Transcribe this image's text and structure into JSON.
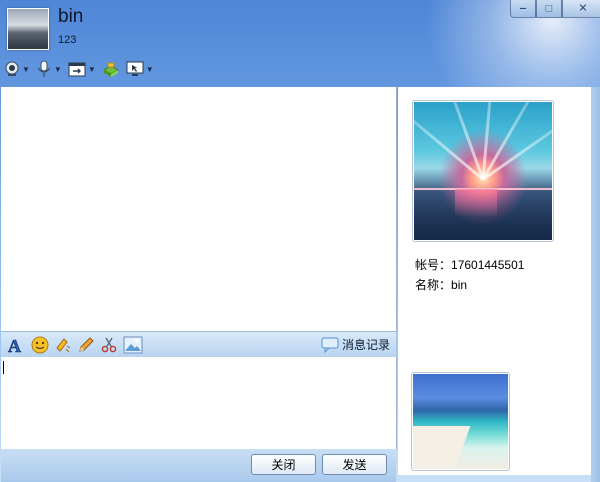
{
  "window": {
    "controls": {
      "minimize": "‒",
      "maximize": "□",
      "close": "✕"
    }
  },
  "header": {
    "name": "bin",
    "status": "123",
    "avatar_icon": "avatar-photo"
  },
  "toolbar": {
    "items": [
      {
        "icon": "camera-icon",
        "dropdown": true
      },
      {
        "icon": "microphone-icon",
        "dropdown": true
      },
      {
        "icon": "file-transfer-icon",
        "dropdown": true
      },
      {
        "icon": "app-box-icon",
        "dropdown": false
      },
      {
        "icon": "screen-share-icon",
        "dropdown": true
      }
    ]
  },
  "input_toolbar": {
    "icons": [
      "font-icon",
      "emoji-icon",
      "shake-icon",
      "pencil-icon",
      "scissors-icon",
      "image-icon"
    ],
    "history_label": "消息记录"
  },
  "buttons": {
    "close": "关闭",
    "send": "发送"
  },
  "profile": {
    "account_label": "帐号：",
    "account_value": "17601445501",
    "name_label": "名称：",
    "name_value": "bin"
  },
  "colors": {
    "title_gradient_top": "#4f86d6",
    "panel_bar": "#b8d4f0",
    "border": "#9bb3d4"
  }
}
